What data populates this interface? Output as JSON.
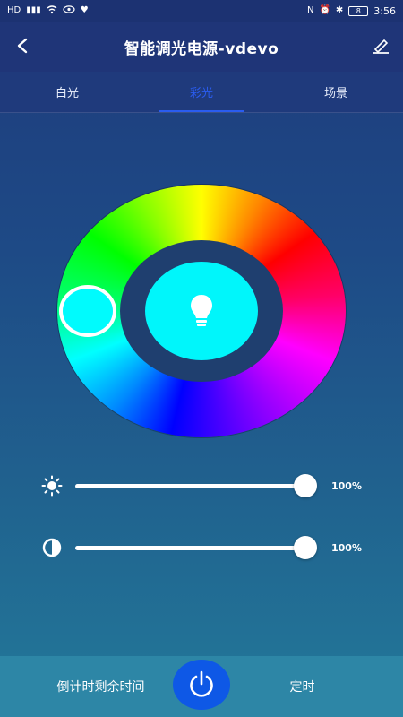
{
  "status_bar": {
    "left_icons": [
      "HD",
      "⁴ᴳ",
      "▮▮▮",
      "wifi",
      "eye",
      "heart"
    ],
    "right_icons": [
      "nfc",
      "alarm",
      "bluetooth"
    ],
    "battery": "8",
    "time": "3:56"
  },
  "header": {
    "title": "智能调光电源-vdevo"
  },
  "tabs": [
    {
      "label": "白光",
      "active": false
    },
    {
      "label": "彩光",
      "active": true
    },
    {
      "label": "场景",
      "active": false
    }
  ],
  "color_picker": {
    "selected_color": "#00f6fb"
  },
  "sliders": {
    "brightness": {
      "value_label": "100%",
      "value": 1.0
    },
    "contrast": {
      "value_label": "100%",
      "value": 1.0
    }
  },
  "bottom_bar": {
    "left_label": "倒计时剩余时间",
    "right_label": "定时"
  },
  "colors": {
    "header_bg": "#1f3578",
    "active_tab": "#2a5cf0",
    "power_button": "#0e58e6",
    "bottom_bar": "#2d86a6"
  }
}
